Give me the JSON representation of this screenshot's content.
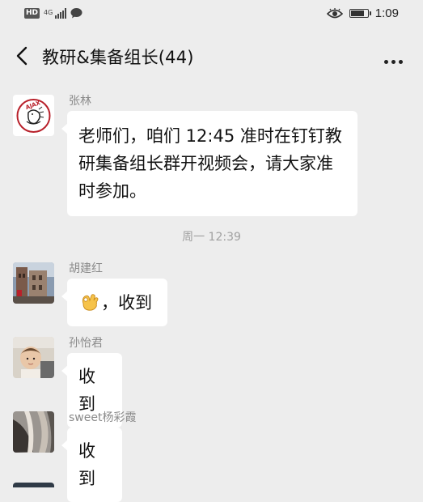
{
  "status_bar": {
    "hd_label": "HD",
    "network_label": "4G",
    "time": "1:09",
    "battery_level": 0.85
  },
  "nav": {
    "title": "教研&集备组长(44)"
  },
  "messages": [
    {
      "sender": "张林",
      "text": "老师们，咱们 12:45 准时在钉钉教研集备组长群开视频会，请大家准时参加。"
    },
    {
      "sender": "胡建红",
      "emoji": "ok-hand",
      "text": "，收到"
    },
    {
      "sender": "孙怡君",
      "text": "收到"
    },
    {
      "sender": "sweet杨彩霞",
      "text": "收到"
    }
  ],
  "time_divider": "周一 12:39",
  "colors": {
    "background": "#ededed",
    "bubble": "#ffffff",
    "sender_name": "#8a8a8a",
    "timestamp": "#a0a0a0"
  }
}
